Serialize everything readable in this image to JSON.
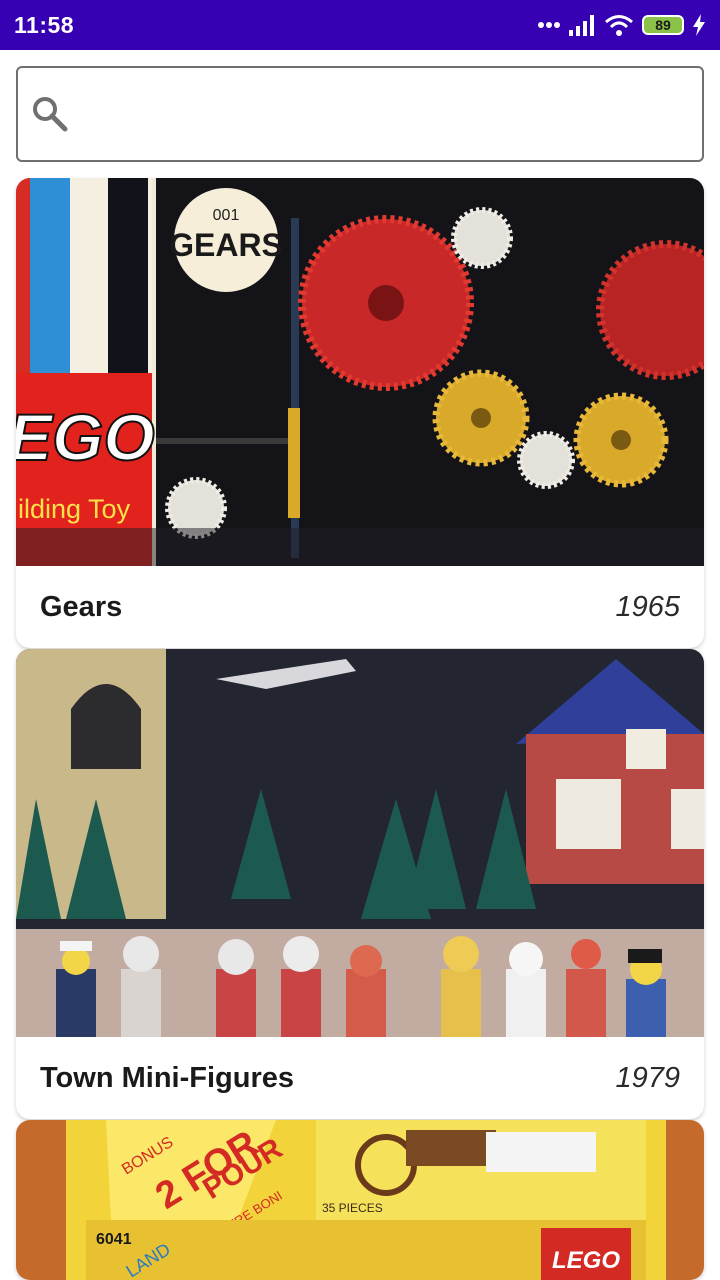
{
  "status_bar": {
    "time": "11:58",
    "battery_level": "89",
    "icons": [
      "signal-dots-icon",
      "cell-signal-icon",
      "wifi-icon",
      "battery-icon",
      "charging-bolt-icon"
    ],
    "background_color": "#3700b3"
  },
  "search": {
    "placeholder": "",
    "value": "",
    "icon": "search-icon"
  },
  "sets": [
    {
      "title": "Gears",
      "year": "1965",
      "image_text": {
        "badge_number": "001",
        "badge_label": "GEARS",
        "logo": "EGO",
        "tagline": "ilding Toy"
      }
    },
    {
      "title": "Town Mini-Figures",
      "year": "1979"
    },
    {
      "title": "",
      "year": "",
      "image_text": {
        "promo": "BONUS",
        "promo_big": "2 FOR",
        "promo_big2": "POUR",
        "promo_small": "OFFRE BONI",
        "set_number": "6041",
        "pieces": "35 PIECES",
        "logo": "LEGO",
        "side_text": "LAND"
      }
    }
  ]
}
